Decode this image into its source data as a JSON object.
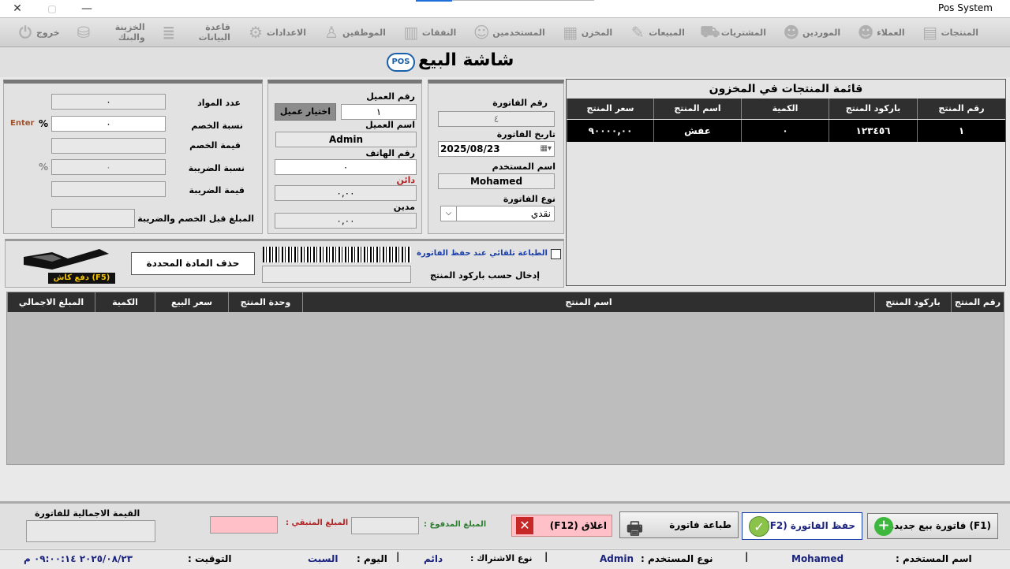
{
  "window": {
    "title": "Pos System",
    "controls": {
      "close": "✕",
      "restore": "▢",
      "minimize": "—"
    }
  },
  "menu": [
    {
      "label": "المنتجات",
      "icon": "products-icon"
    },
    {
      "label": "العملاء",
      "icon": "customers-icon"
    },
    {
      "label": "الموردين",
      "icon": "suppliers-icon"
    },
    {
      "label": "المشتريات",
      "icon": "purchases-icon"
    },
    {
      "label": "المبيعات",
      "icon": "sales-icon"
    },
    {
      "label": "المخزن",
      "icon": "warehouse-icon"
    },
    {
      "label": "المستخدمين",
      "icon": "users-icon"
    },
    {
      "label": "النفقات",
      "icon": "expenses-icon"
    },
    {
      "label": "الموظفين",
      "icon": "employees-icon"
    },
    {
      "label": "الاعدادات",
      "icon": "settings-icon"
    },
    {
      "label": "قاعدة البيانات",
      "icon": "database-icon"
    },
    {
      "label": "الخزينة والبنك",
      "icon": "treasury-icon"
    },
    {
      "label": "خروج",
      "icon": "power-icon"
    }
  ],
  "screen_title": "شاشة البيع",
  "logo_text": "POS",
  "summary": {
    "items_count_label": "عدد المواد",
    "items_count": "٠",
    "discount_pct_label": "نسبة الخصم",
    "discount_pct": "٠",
    "pct_symbol": "%",
    "enter_hint": "Enter",
    "discount_value_label": "قيمة الخصم",
    "discount_value": "",
    "tax_pct_label": "نسبة الضريبة",
    "tax_pct": "٠",
    "tax_value_label": "قيمة الضريبة",
    "tax_value": "",
    "amount_before_label": "المبلغ قبل الخصم والضريبة",
    "amount_before": ""
  },
  "customer": {
    "number_label": "رقم العميل",
    "number": "١",
    "select_button": "اختيار عميل",
    "name_label": "اسم العميل",
    "name": "Admin",
    "phone_label": "رقم الهاتف",
    "phone": "٠",
    "creditor_label": "دائن",
    "creditor": "٠,٠٠",
    "debtor_label": "مدين",
    "debtor": "٠,٠٠"
  },
  "invoice": {
    "number_label": "رقم الفاتورة",
    "number": "٤",
    "date_label": "تاريخ الفاتورة",
    "date": "2025/08/23",
    "user_label": "اسم المستخدم",
    "user": "Mohamed",
    "type_label": "نوع الفاتورة",
    "type": "نقدي"
  },
  "inventory": {
    "title": "قائمة المنتجات في المخزون",
    "columns": [
      "رقم المنتج",
      "باركود المنتج",
      "الكمية",
      "اسم المنتج",
      "سعر المنتج"
    ],
    "rows": [
      [
        "١",
        "١٢٣٤٥٦",
        "٠",
        "عفش",
        "٩٠٠٠٠,٠٠"
      ]
    ]
  },
  "barcode": {
    "auto_print_label": "الطباعة تلقائي عند حفظ الفاتورة",
    "entry_label": "إدخال حسب باركود المنتج",
    "delete_button": "حذف المادة المحددة",
    "cash_label": "دفع كاش (F5)"
  },
  "cart": {
    "columns": [
      "رقم المنتج",
      "باركود المنتج",
      "اسم المنتج",
      "وحدة المنتج",
      "سعر البيع",
      "الكمية",
      "المبلغ الاجمالي"
    ]
  },
  "footer": {
    "total_label": "القيمة الاجمالية للفاتورة",
    "total": "",
    "remaining_label": "المبلغ المتبقي :",
    "remaining": "",
    "paid_label": "المبلغ المدفوع :",
    "paid": "",
    "close_button": "اغلاق (F12)",
    "print_button": "طباعة فاتورة",
    "save_button": "حفظ الفاتورة (F2)",
    "new_button": "(F1) فاتورة بيع جديدة"
  },
  "status": {
    "user_label": "اسم المستخدم :",
    "user": "Mohamed",
    "user_type_label": "نوع المستخدم :",
    "user_type": "Admin",
    "subscription_label": "نوع الاشتراك :",
    "subscription": "دائم",
    "day_label": "اليوم :",
    "day": "السبت",
    "time_label": "التوقيت :",
    "time": "٢٠٢٥/٠٨/٢٣ ٠٩:٠٠:١٤ م"
  },
  "colors": {
    "grid_header": "#2f2f2f",
    "selected_row": "#000000",
    "remaining_field": "#ffc0c8",
    "close_button": "#ffc0c8",
    "accent_green": "#3db73d"
  }
}
